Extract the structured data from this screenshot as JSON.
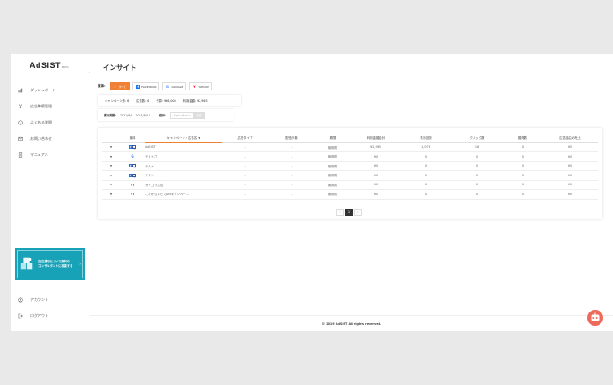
{
  "brand": {
    "logo": "AdSIST",
    "beta": "BETA"
  },
  "sidebar": {
    "items": [
      {
        "label": "ダッシュボード",
        "icon": "chart-bar-icon"
      },
      {
        "label": "広告準備管理",
        "icon": "yen-icon"
      },
      {
        "label": "よくある質問",
        "icon": "question-circle-icon"
      },
      {
        "label": "お問い合わせ",
        "icon": "mail-icon"
      },
      {
        "label": "マニュアル",
        "icon": "document-icon"
      }
    ],
    "banner": {
      "line1": "広告運用について無料の",
      "line2": "コンサルタントに相談する",
      "arrow": "›"
    },
    "bottom_items": [
      {
        "label": "アカウント",
        "icon": "user-circle-icon"
      },
      {
        "label": "ログアウト",
        "icon": "logout-icon"
      }
    ],
    "collapse": "›"
  },
  "page": {
    "title": "インサイト"
  },
  "filter": {
    "label": "媒体:",
    "chips": [
      {
        "label": "すべて",
        "active": true
      },
      {
        "label": "FACEBOOK",
        "active": false
      },
      {
        "label": "GOOGLE",
        "active": false
      },
      {
        "label": "YAHOO!",
        "active": false
      }
    ]
  },
  "stats": {
    "campaigns": "キャンペーン数: 6",
    "ads": "広告数: 6",
    "budget": "予算: ¥96,000",
    "spend": "利用金額: ¥2,965"
  },
  "period": {
    "label": "集計期間:",
    "value": "2021/8/8 - 2021/8/18",
    "media_label": "媒体:",
    "select": "キャンペーン",
    "button": "設定"
  },
  "table": {
    "headers": [
      "媒体",
      "キャンペーン・広告名",
      "広告タイプ",
      "配信対象",
      "期間",
      "利用金額合計",
      "表示回数",
      "クリック数",
      "獲得数",
      "広告経由の売上"
    ],
    "rows": [
      {
        "media": "facebook",
        "name": "AdSIST",
        "type": "-",
        "target": "-",
        "period": "無期限",
        "spend": "¥2,965",
        "imps": "1,078",
        "clicks": "16",
        "cv": "0",
        "sales": "¥0"
      },
      {
        "media": "google",
        "name": "テストさ",
        "type": "-",
        "target": "-",
        "period": "無期限",
        "spend": "¥0",
        "imps": "0",
        "clicks": "0",
        "cv": "0",
        "sales": "¥0"
      },
      {
        "media": "facebook",
        "name": "テスト",
        "type": "-",
        "target": "-",
        "period": "無期限",
        "spend": "¥0",
        "imps": "0",
        "clicks": "0",
        "cv": "0",
        "sales": "¥0"
      },
      {
        "media": "facebook",
        "name": "テスト",
        "type": "-",
        "target": "-",
        "period": "無期限",
        "spend": "¥0",
        "imps": "0",
        "clicks": "0",
        "cv": "0",
        "sales": "¥0"
      },
      {
        "media": "yahoo",
        "name": "カテゴリ広告",
        "type": "-",
        "target": "-",
        "period": "無期限",
        "spend": "¥0",
        "imps": "0",
        "clicks": "0",
        "cv": "0",
        "sales": "¥0"
      },
      {
        "media": "yahoo",
        "name": "これからエビでDNキャンペー...",
        "type": "-",
        "target": "-",
        "period": "無期限",
        "spend": "¥0",
        "imps": "0",
        "clicks": "0",
        "cv": "0",
        "sales": "¥0"
      }
    ]
  },
  "pagination": {
    "prev": "‹",
    "current": "1",
    "next": "›"
  },
  "footer": {
    "copyright": "© 2019 AdSIST All rights reserved."
  },
  "colors": {
    "accent": "#f08033",
    "banner": "#17a2b8",
    "chat": "#ef6a5a"
  }
}
